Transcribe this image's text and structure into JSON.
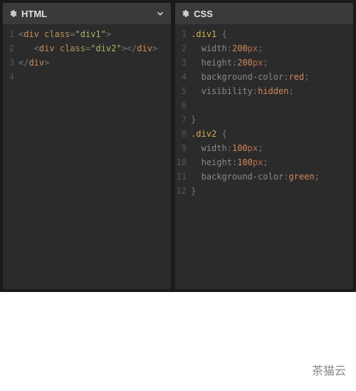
{
  "panes": {
    "html": {
      "title": "HTML",
      "gear_icon": "gear",
      "chevron_icon": "chevron-down",
      "line_numbers": [
        "1",
        "2",
        "3",
        "4"
      ],
      "lines": [
        {
          "tokens": [
            {
              "cls": "t-punct",
              "t": "<"
            },
            {
              "cls": "t-tag",
              "t": "div"
            },
            {
              "cls": "",
              "t": " "
            },
            {
              "cls": "t-attr",
              "t": "class"
            },
            {
              "cls": "t-punct",
              "t": "="
            },
            {
              "cls": "t-str",
              "t": "\"div1\""
            },
            {
              "cls": "t-punct",
              "t": ">"
            }
          ]
        },
        {
          "indent": 3,
          "tokens": [
            {
              "cls": "t-punct",
              "t": "<"
            },
            {
              "cls": "t-tag",
              "t": "div"
            },
            {
              "cls": "",
              "t": " "
            },
            {
              "cls": "t-attr",
              "t": "class"
            },
            {
              "cls": "t-punct",
              "t": "="
            },
            {
              "cls": "t-str",
              "t": "\"div2\""
            },
            {
              "cls": "t-punct",
              "t": "></"
            },
            {
              "cls": "t-tag",
              "t": "div"
            },
            {
              "cls": "t-punct",
              "t": ">"
            }
          ]
        },
        {
          "tokens": [
            {
              "cls": "t-punct",
              "t": "</"
            },
            {
              "cls": "t-tag",
              "t": "div"
            },
            {
              "cls": "t-punct",
              "t": ">"
            }
          ]
        },
        {
          "tokens": []
        }
      ]
    },
    "css": {
      "title": "CSS",
      "gear_icon": "gear",
      "line_numbers": [
        "1",
        "2",
        "3",
        "4",
        "5",
        "6",
        "7",
        "8",
        "9",
        "10",
        "11",
        "12"
      ],
      "lines": [
        {
          "tokens": [
            {
              "cls": "t-sel",
              "t": ".div1"
            },
            {
              "cls": "",
              "t": " "
            },
            {
              "cls": "t-punct",
              "t": "{"
            }
          ]
        },
        {
          "indent": 2,
          "tokens": [
            {
              "cls": "t-prop",
              "t": "width"
            },
            {
              "cls": "t-punct",
              "t": ":"
            },
            {
              "cls": "t-num",
              "t": "200"
            },
            {
              "cls": "t-unit",
              "t": "px"
            },
            {
              "cls": "t-punct",
              "t": ";"
            }
          ]
        },
        {
          "indent": 2,
          "tokens": [
            {
              "cls": "t-prop",
              "t": "height"
            },
            {
              "cls": "t-punct",
              "t": ":"
            },
            {
              "cls": "t-num",
              "t": "200"
            },
            {
              "cls": "t-unit",
              "t": "px"
            },
            {
              "cls": "t-punct",
              "t": ";"
            }
          ]
        },
        {
          "indent": 2,
          "tokens": [
            {
              "cls": "t-prop",
              "t": "background-color"
            },
            {
              "cls": "t-punct",
              "t": ":"
            },
            {
              "cls": "t-val",
              "t": "red"
            },
            {
              "cls": "t-punct",
              "t": ";"
            }
          ]
        },
        {
          "indent": 2,
          "tokens": [
            {
              "cls": "t-prop",
              "t": "visibility"
            },
            {
              "cls": "t-punct",
              "t": ":"
            },
            {
              "cls": "t-val",
              "t": "hidden"
            },
            {
              "cls": "t-punct",
              "t": ";"
            }
          ]
        },
        {
          "tokens": []
        },
        {
          "tokens": [
            {
              "cls": "t-punct",
              "t": "}"
            }
          ]
        },
        {
          "tokens": [
            {
              "cls": "t-sel",
              "t": ".div2"
            },
            {
              "cls": "",
              "t": " "
            },
            {
              "cls": "t-punct",
              "t": "{"
            }
          ]
        },
        {
          "indent": 2,
          "tokens": [
            {
              "cls": "t-prop",
              "t": "width"
            },
            {
              "cls": "t-punct",
              "t": ":"
            },
            {
              "cls": "t-num",
              "t": "100"
            },
            {
              "cls": "t-unit",
              "t": "px"
            },
            {
              "cls": "t-punct",
              "t": ";"
            }
          ]
        },
        {
          "indent": 2,
          "tokens": [
            {
              "cls": "t-prop",
              "t": "height"
            },
            {
              "cls": "t-punct",
              "t": ":"
            },
            {
              "cls": "t-num",
              "t": "100"
            },
            {
              "cls": "t-unit",
              "t": "px"
            },
            {
              "cls": "t-punct",
              "t": ";"
            }
          ]
        },
        {
          "indent": 2,
          "tokens": [
            {
              "cls": "t-prop",
              "t": "background-color"
            },
            {
              "cls": "t-punct",
              "t": ":"
            },
            {
              "cls": "t-val",
              "t": "green"
            },
            {
              "cls": "t-punct",
              "t": ";"
            }
          ]
        },
        {
          "tokens": [
            {
              "cls": "t-punct",
              "t": "}"
            }
          ]
        }
      ]
    }
  },
  "watermark": "茶猫云"
}
